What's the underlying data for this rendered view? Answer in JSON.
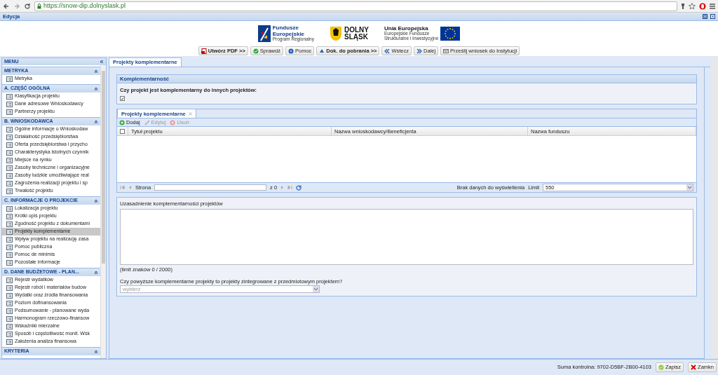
{
  "browser": {
    "url": "https://snow-dip.dolnyslask.pl"
  },
  "window": {
    "title": "Edycja"
  },
  "logos": {
    "fe": [
      "Fundusze",
      "Europejskie",
      "Program Regionalny"
    ],
    "region": [
      "DOLNY",
      "ŚLĄSK"
    ],
    "eu": [
      "Unia Europejska",
      "Europejskie Fundusze",
      "Strukturalne i Inwestycyjne"
    ]
  },
  "toolbar": [
    {
      "label": "Utwórz PDF >>",
      "kind": "pdf",
      "bold": true
    },
    {
      "label": "Sprawdź",
      "kind": "check",
      "bold": false
    },
    {
      "label": "Pomoc",
      "kind": "help",
      "bold": false
    },
    {
      "label": "Dok. do pobrania >>",
      "kind": "docs",
      "bold": true
    },
    {
      "label": "Wstecz",
      "kind": "back",
      "bold": false
    },
    {
      "label": "Dalej",
      "kind": "next",
      "bold": false
    },
    {
      "label": "Prześlij wniosek do Instytucji",
      "kind": "send",
      "bold": false
    }
  ],
  "sidebar": {
    "title": "MENU",
    "sections": [
      {
        "title": "METRYKA",
        "items": [
          {
            "label": "Metryka",
            "selected": false
          }
        ]
      },
      {
        "title": "A. CZĘŚĆ OGÓLNA",
        "items": [
          {
            "label": "Klasyfikacja projektu",
            "selected": false
          },
          {
            "label": "Dane adresowe Wnioskodawcy",
            "selected": false
          },
          {
            "label": "Partnerzy projektu",
            "selected": false
          }
        ]
      },
      {
        "title": "B. WNIOSKODAWCA",
        "items": [
          {
            "label": "Ogólne informacje o Wnioskodaw",
            "selected": false
          },
          {
            "label": "Działalność przedsiębiorstwa",
            "selected": false
          },
          {
            "label": "Oferta przedsiębiorstwa i przycho",
            "selected": false
          },
          {
            "label": "Charakterystyka istotnych czynnik",
            "selected": false
          },
          {
            "label": "Miejsce na rynku",
            "selected": false
          },
          {
            "label": "Zasoby techniczne i organizacyjne",
            "selected": false
          },
          {
            "label": "Zasoby ludzkie umożliwiające real",
            "selected": false
          },
          {
            "label": "Zagrożenia realizacji projektu i sp",
            "selected": false
          },
          {
            "label": "Trwałość projektu",
            "selected": false
          }
        ]
      },
      {
        "title": "C. INFORMACJE O PROJEKCIE",
        "items": [
          {
            "label": "Lokalizacja projektu",
            "selected": false
          },
          {
            "label": "Krótki opis projektu",
            "selected": false
          },
          {
            "label": "Zgodność projektu z dokumentami",
            "selected": false
          },
          {
            "label": "Projekty komplementarne",
            "selected": true
          },
          {
            "label": "Wpływ projektu na realizację zasa",
            "selected": false
          },
          {
            "label": "Pomoc publiczna",
            "selected": false
          },
          {
            "label": "Pomoc de minimis",
            "selected": false
          },
          {
            "label": "Pozostałe informacje",
            "selected": false
          }
        ]
      },
      {
        "title": "D. DANE BUDŻETOWE - PLAN...",
        "items": [
          {
            "label": "Rejestr wydatków",
            "selected": false
          },
          {
            "label": "Rejestr robót i materiałów budow",
            "selected": false
          },
          {
            "label": "Wydatki oraz źródła finansowania",
            "selected": false
          },
          {
            "label": "Poziom dofinansowania",
            "selected": false
          },
          {
            "label": "Podsumowanie - planowane wyda",
            "selected": false
          },
          {
            "label": "Harmonogram rzeczowo-finansow",
            "selected": false
          },
          {
            "label": "Wskaźniki mierzalne",
            "selected": false
          },
          {
            "label": "Sposób i częstotliwość monit. Wsk",
            "selected": false
          },
          {
            "label": "Założenia analiza finansowa",
            "selected": false
          }
        ]
      },
      {
        "title": "KRYTERIA"
      }
    ]
  },
  "main_tab": {
    "label": "Projekty komplementarne",
    "selected": true
  },
  "fieldset": {
    "title": "Komplementarność",
    "question": "Czy projekt jest komplementarny do innych projektów:",
    "checked": true
  },
  "grid": {
    "tab": "Projekty komplementarne",
    "actions": [
      {
        "label": "Dodaj",
        "kind": "add",
        "disabled": false
      },
      {
        "label": "Edytuj",
        "kind": "edit",
        "disabled": true
      },
      {
        "label": "Usuń",
        "kind": "delete",
        "disabled": true
      }
    ],
    "header_checked": false,
    "columns": [
      "Tytuł projektu",
      "Nazwa wnioskodawcy/Beneficjenta",
      "Nazwa funduszu"
    ],
    "paging": {
      "page_label": "Strona",
      "of": "z 0",
      "empty": "Brak danych do wyświetlenia",
      "limit_label": "Limit",
      "limit": "550"
    }
  },
  "justification": {
    "label": "Uzasadnienie komplementarności projektów",
    "counter": "(limit znaków 0 / 2000)"
  },
  "integrated": {
    "label": "Czy powyższe komplementarne projekty to projekty zintegrowane z przedmiotowym projektem?",
    "placeholder": "wybierz"
  },
  "status": {
    "checksum": "Suma kontrolna: 9702-D5BF-2B00-4103",
    "buttons": [
      {
        "label": "Zapisz",
        "kind": "save"
      },
      {
        "label": "Zamkn",
        "kind": "close"
      }
    ]
  }
}
